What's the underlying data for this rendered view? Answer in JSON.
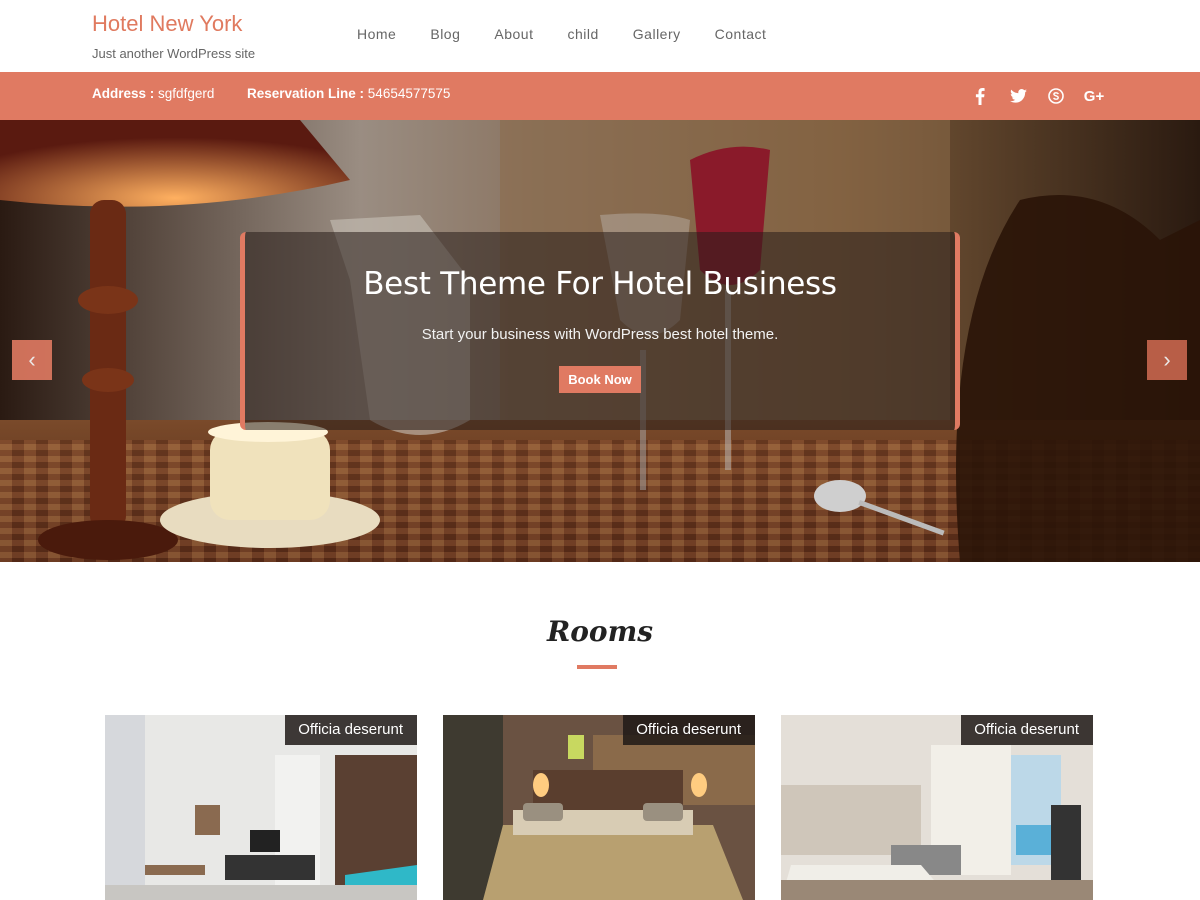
{
  "site": {
    "title": "Hotel New York",
    "description": "Just another WordPress site"
  },
  "nav": {
    "items": [
      "Home",
      "Blog",
      "About",
      "child",
      "Gallery",
      "Contact"
    ]
  },
  "infobar": {
    "address_label": "Address :",
    "address_value": "sgfdfgerd",
    "reservation_label": "Reservation Line :",
    "reservation_value": "54654577575",
    "social": [
      "facebook-icon",
      "twitter-icon",
      "skype-icon",
      "google-plus-icon"
    ],
    "social_glyphs": [
      "f",
      "t",
      "S",
      "G+"
    ],
    "background_color": "#e07a62"
  },
  "hero": {
    "title": "Best Theme For Hotel Business",
    "subtitle": "Start your business with WordPress best hotel theme.",
    "button_label": "Book Now",
    "prev_glyph": "‹",
    "next_glyph": "›"
  },
  "rooms": {
    "heading": "Rooms",
    "cards": [
      {
        "label": "Officia deserunt"
      },
      {
        "label": "Officia deserunt"
      },
      {
        "label": "Officia deserunt"
      }
    ]
  },
  "colors": {
    "accent": "#e07a62",
    "title": "#e07a5f"
  }
}
